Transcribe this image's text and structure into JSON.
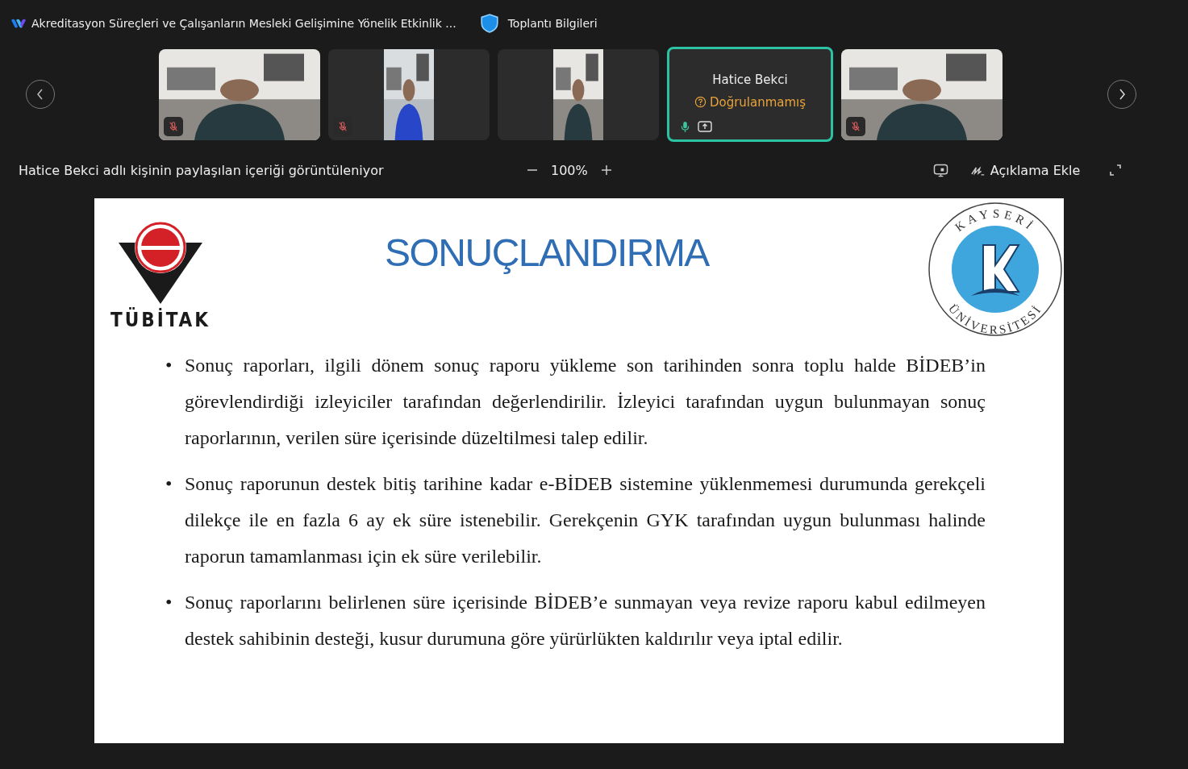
{
  "window": {
    "title": "Akreditasyon Süreçleri ve Çalışanların Mesleki Gelişimine Yönelik Etkinlik ...",
    "meeting_info": "Toplantı Bilgileri"
  },
  "participants": [
    {
      "kind": "video",
      "muted": true,
      "speaking": false
    },
    {
      "kind": "portrait",
      "muted": true,
      "speaking": false
    },
    {
      "kind": "portrait",
      "muted": false,
      "speaking": false
    },
    {
      "kind": "card",
      "name": "Hatice Bekci",
      "status": "Doğrulanmamış",
      "muted": false,
      "sharing": true,
      "speaking": true
    },
    {
      "kind": "video",
      "muted": true,
      "speaking": false
    }
  ],
  "share_bar": {
    "caption": "Hatice Bekci adlı kişinin paylaşılan içeriği görüntüleniyor",
    "zoom": "100%",
    "annotate": "Açıklama Ekle"
  },
  "slide": {
    "title": "SONUÇLANDIRMA",
    "left_logo": "TÜBİTAK",
    "right_logo_top": "KAYSERİ",
    "right_logo_bottom": "ÜNİVERSİTESİ",
    "bullets": [
      {
        "marker": "•",
        "text": "Sonuç raporları, ilgili dönem sonuç raporu yükleme son tarihinden sonra toplu halde BİDEB’in görevlendirdiği izleyiciler tarafından değerlendirilir. İzleyici tarafından uygun bulunmayan sonuç raporlarının, verilen süre içerisinde düzeltilmesi talep edilir."
      },
      {
        "marker": "•",
        "text": "Sonuç raporunun destek bitiş tarihine kadar e-BİDEB sistemine yüklenmemesi durumunda gerekçeli dilekçe ile en fazla 6 ay ek süre istenebilir. Gerekçenin GYK tarafından uygun bulunması halinde raporun tamamlanması için ek süre verilebilir."
      },
      {
        "marker": "•",
        "text": "Sonuç raporlarını belirlenen süre içerisinde BİDEB’e sunmayan veya revize raporu kabul edilmeyen destek sahibinin desteği, kusur durumuna göre yürürlükten kaldırılır veya iptal edilir."
      }
    ]
  }
}
